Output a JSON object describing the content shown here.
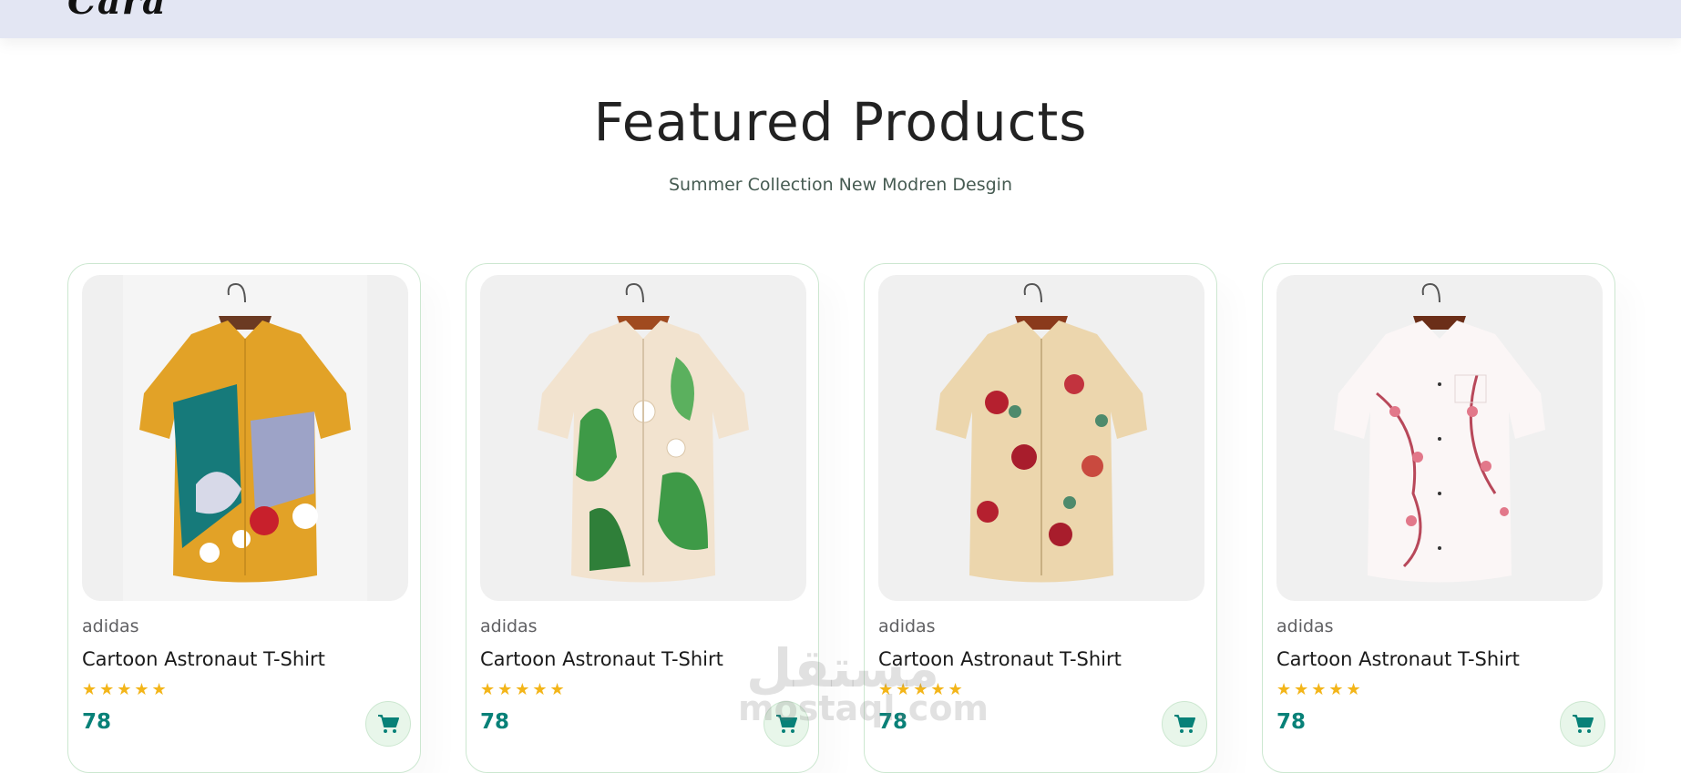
{
  "header": {
    "logo_text": "Cara"
  },
  "section": {
    "title": "Featured Products",
    "subtitle": "Summer Collection New Modren Desgin"
  },
  "products": [
    {
      "brand": "adidas",
      "name": "Cartoon Astronaut T-Shirt",
      "rating": 5,
      "stars": "★★★★★",
      "price": "78",
      "image": "shirt-abstract-print"
    },
    {
      "brand": "adidas",
      "name": "Cartoon Astronaut T-Shirt",
      "rating": 5,
      "stars": "★★★★★",
      "price": "78",
      "image": "shirt-tropical-leaf-print"
    },
    {
      "brand": "adidas",
      "name": "Cartoon Astronaut T-Shirt",
      "rating": 5,
      "stars": "★★★★★",
      "price": "78",
      "image": "shirt-rose-floral-print"
    },
    {
      "brand": "adidas",
      "name": "Cartoon Astronaut T-Shirt",
      "rating": 5,
      "stars": "★★★★★",
      "price": "78",
      "image": "shirt-cherry-blossom-print"
    }
  ],
  "watermark": {
    "arabic": "مستقل",
    "latin": "mostaql.com"
  },
  "colors": {
    "accent": "#088178",
    "star": "#f3b519",
    "header_bg": "#e3e6f3",
    "card_border": "#cce7d0"
  }
}
